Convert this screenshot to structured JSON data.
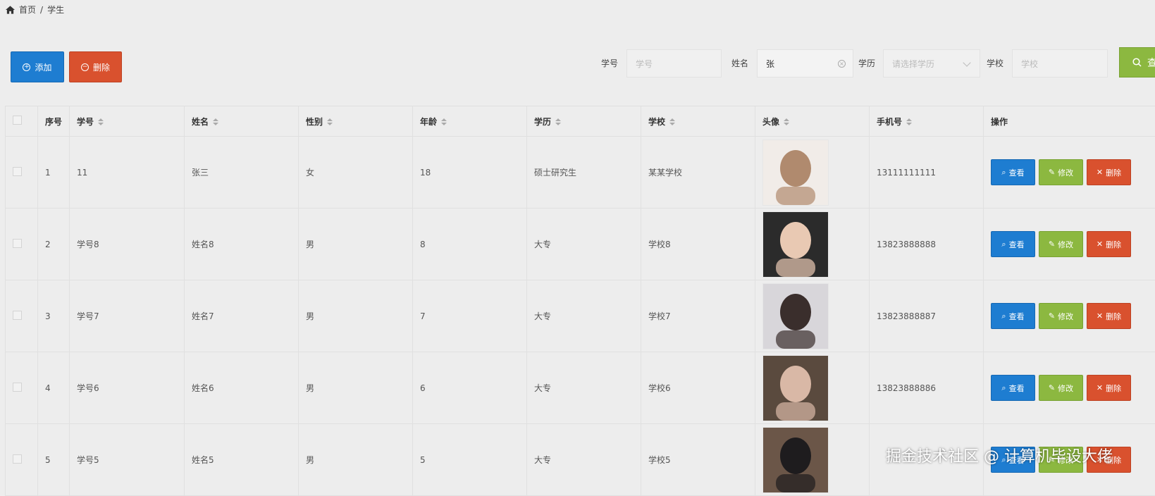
{
  "breadcrumb": {
    "home_icon": "home-icon",
    "home": "首页",
    "sep": "/",
    "current": "学生"
  },
  "toolbar": {
    "add_label": "添加",
    "delete_label": "删除"
  },
  "search": {
    "student_no_label": "学号",
    "student_no_placeholder": "学号",
    "name_label": "姓名",
    "name_value": "张",
    "education_label": "学历",
    "education_placeholder": "请选择学历",
    "school_label": "学校",
    "school_placeholder": "学校",
    "search_label": "查"
  },
  "table": {
    "headers": [
      "序号",
      "学号",
      "姓名",
      "性别",
      "年龄",
      "学历",
      "学校",
      "头像",
      "手机号",
      "操作"
    ],
    "row_buttons": {
      "view": "查看",
      "edit": "修改",
      "delete": "删除"
    },
    "rows": [
      {
        "index": "1",
        "student_no": "11",
        "name": "张三",
        "gender": "女",
        "age": "18",
        "education": "硕士研究生",
        "school": "某某学校",
        "phone": "13111111111"
      },
      {
        "index": "2",
        "student_no": "学号8",
        "name": "姓名8",
        "gender": "男",
        "age": "8",
        "education": "大专",
        "school": "学校8",
        "phone": "13823888888"
      },
      {
        "index": "3",
        "student_no": "学号7",
        "name": "姓名7",
        "gender": "男",
        "age": "7",
        "education": "大专",
        "school": "学校7",
        "phone": "13823888887"
      },
      {
        "index": "4",
        "student_no": "学号6",
        "name": "姓名6",
        "gender": "男",
        "age": "6",
        "education": "大专",
        "school": "学校6",
        "phone": "13823888886"
      },
      {
        "index": "5",
        "student_no": "学号5",
        "name": "姓名5",
        "gender": "男",
        "age": "5",
        "education": "大专",
        "school": "学校5",
        "phone": ""
      }
    ]
  },
  "watermark": "掘金技术社区 @ 计算机毕设大佬",
  "colors": {
    "primary": "#1e7dd1",
    "success": "#8cb840",
    "danger": "#d9512e"
  }
}
